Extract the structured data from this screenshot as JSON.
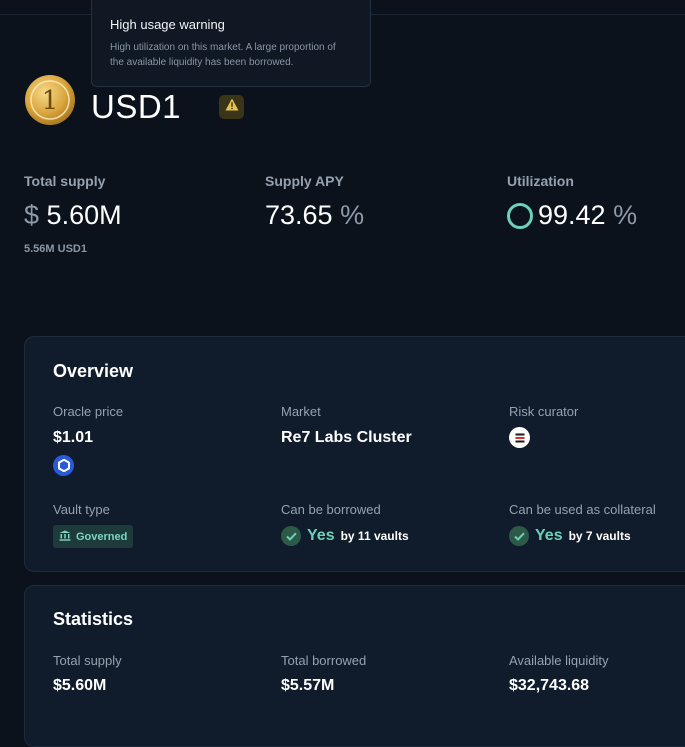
{
  "tooltip": {
    "title": "High usage warning",
    "body": "High utilization on this market. A large proportion of the available liquidity has been borrowed."
  },
  "token": {
    "name": "USD1",
    "coin_glyph": "1",
    "warning_icon": "warning-triangle-icon"
  },
  "stats": {
    "total_supply": {
      "label": "Total supply",
      "prefix": "$",
      "value": "5.60M",
      "sub": "5.56M USD1"
    },
    "supply_apy": {
      "label": "Supply APY",
      "value": "73.65",
      "suffix": "%"
    },
    "utilization": {
      "label": "Utilization",
      "value": "99.42",
      "suffix": "%"
    }
  },
  "overview": {
    "title": "Overview",
    "oracle_price": {
      "label": "Oracle price",
      "value": "$1.01",
      "icon": "chainlink-icon"
    },
    "market": {
      "label": "Market",
      "value": "Re7 Labs Cluster"
    },
    "risk_curator": {
      "label": "Risk curator",
      "icon": "re7-curator-icon"
    },
    "vault_type": {
      "label": "Vault type",
      "badge": "Governed",
      "icon": "bank-icon"
    },
    "can_be_borrowed": {
      "label": "Can be borrowed",
      "yes": "Yes",
      "by": "by 11 vaults"
    },
    "collateral": {
      "label": "Can be used as collateral",
      "yes": "Yes",
      "by": "by 7 vaults"
    }
  },
  "statistics": {
    "title": "Statistics",
    "total_supply": {
      "label": "Total supply",
      "value": "$5.60M"
    },
    "total_borrowed": {
      "label": "Total borrowed",
      "value": "$5.57M"
    },
    "available_liquidity": {
      "label": "Available liquidity",
      "value": "$32,743.68"
    }
  },
  "colors": {
    "background": "#0b121c",
    "card": "#101c2b",
    "accent_green": "#6ad1ba",
    "warning_yellow": "#e8c24a"
  }
}
